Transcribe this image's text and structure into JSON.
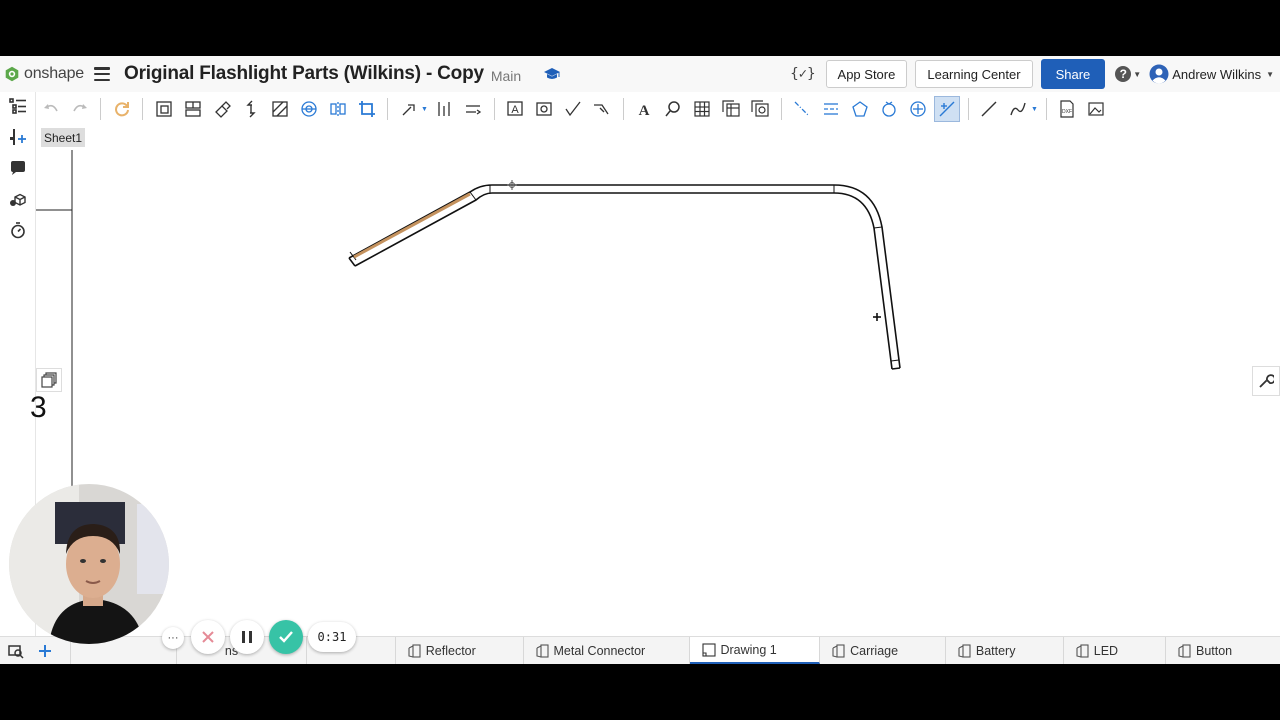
{
  "app": {
    "logo_text": "onshape"
  },
  "document": {
    "title": "Original Flashlight Parts (Wilkins) - Copy",
    "branch": "Main"
  },
  "header": {
    "app_store": "App Store",
    "learning_center": "Learning Center",
    "share": "Share",
    "help": "?",
    "user_name": "Andrew Wilkins"
  },
  "sheet": {
    "active": "Sheet1",
    "visible_number": "3"
  },
  "tabs": [
    {
      "label": "Reflector"
    },
    {
      "label": "Metal Connector"
    },
    {
      "label": "Drawing 1",
      "active": true
    },
    {
      "label": "Carriage"
    },
    {
      "label": "Battery"
    },
    {
      "label": "LED"
    },
    {
      "label": "Button"
    }
  ],
  "partial_tabs": [
    "ns"
  ],
  "recorder": {
    "elapsed": "0:31",
    "more": "···"
  },
  "colors": {
    "accent": "#1f5fb8",
    "highlight_edge": "#c4925e",
    "confirm": "#37c3a6",
    "cancel": "#e58a96"
  }
}
